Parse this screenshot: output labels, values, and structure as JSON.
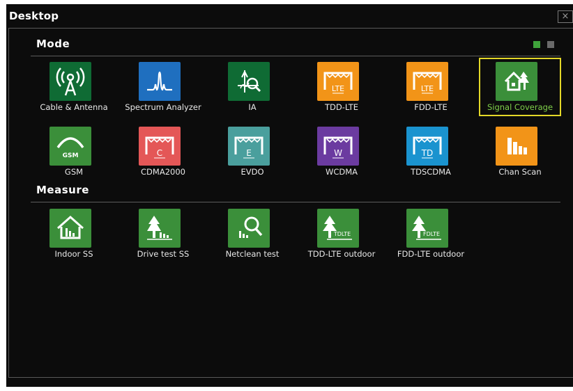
{
  "window": {
    "title": "Desktop",
    "close_glyph": "×"
  },
  "colors": {
    "green": "#3b8f3a",
    "green_dark": "#0f6b34",
    "blue": "#1f6fbf",
    "orange": "#f29418",
    "red": "#e45757",
    "teal": "#4a9f9d",
    "purple": "#6b3ba0",
    "cyan": "#1a93cf",
    "selection": "#e4d828",
    "selected_label": "#7fcf4a"
  },
  "pager": {
    "active_color": "#3fa33b",
    "inactive_color": "#6a6a6a"
  },
  "mode": {
    "title": "Mode",
    "items": [
      {
        "label": "Cable & Antenna",
        "icon": "antenna-icon",
        "color": "#0f6b34",
        "selected": false
      },
      {
        "label": "Spectrum Analyzer",
        "icon": "spectrum-icon",
        "color": "#1f6fbf",
        "selected": false
      },
      {
        "label": "IA",
        "icon": "interference-analyzer-icon",
        "color": "#0f6b34",
        "selected": false
      },
      {
        "label": "TDD-LTE",
        "icon": "lte-frame-icon",
        "icon_text": "LTE",
        "color": "#f29418",
        "selected": false
      },
      {
        "label": "FDD-LTE",
        "icon": "lte-frame-icon",
        "icon_text": "LTE",
        "color": "#f29418",
        "selected": false
      },
      {
        "label": "Signal Coverage",
        "icon": "house-signal-icon",
        "color": "#3b8f3a",
        "selected": true
      },
      {
        "label": "GSM",
        "icon": "gsm-arc-icon",
        "icon_text": "GSM",
        "color": "#3b8f3a",
        "selected": false
      },
      {
        "label": "CDMA2000",
        "icon": "cdma-frame-icon",
        "icon_text": "C",
        "color": "#e45757",
        "selected": false
      },
      {
        "label": "EVDO",
        "icon": "evdo-frame-icon",
        "icon_text": "E",
        "color": "#4a9f9d",
        "selected": false
      },
      {
        "label": "WCDMA",
        "icon": "wcdma-frame-icon",
        "icon_text": "W",
        "color": "#6b3ba0",
        "selected": false
      },
      {
        "label": "TDSCDMA",
        "icon": "tdscdma-frame-icon",
        "icon_text": "TD",
        "color": "#1a93cf",
        "selected": false
      },
      {
        "label": "Chan Scan",
        "icon": "channel-scan-icon",
        "color": "#f29418",
        "selected": false
      }
    ]
  },
  "measure": {
    "title": "Measure",
    "items": [
      {
        "label": "Indoor SS",
        "icon": "indoor-house-icon",
        "color": "#3b8f3a"
      },
      {
        "label": "Drive test SS",
        "icon": "drive-tree-icon",
        "color": "#3b8f3a"
      },
      {
        "label": "Netclean test",
        "icon": "magnifier-icon",
        "color": "#3b8f3a"
      },
      {
        "label": "TDD-LTE outdoor",
        "icon": "tree-tdlte-icon",
        "icon_text": "TDLTE",
        "color": "#3b8f3a"
      },
      {
        "label": "FDD-LTE outdoor",
        "icon": "tree-fdlte-icon",
        "icon_text": "FDLTE",
        "color": "#3b8f3a"
      }
    ]
  }
}
